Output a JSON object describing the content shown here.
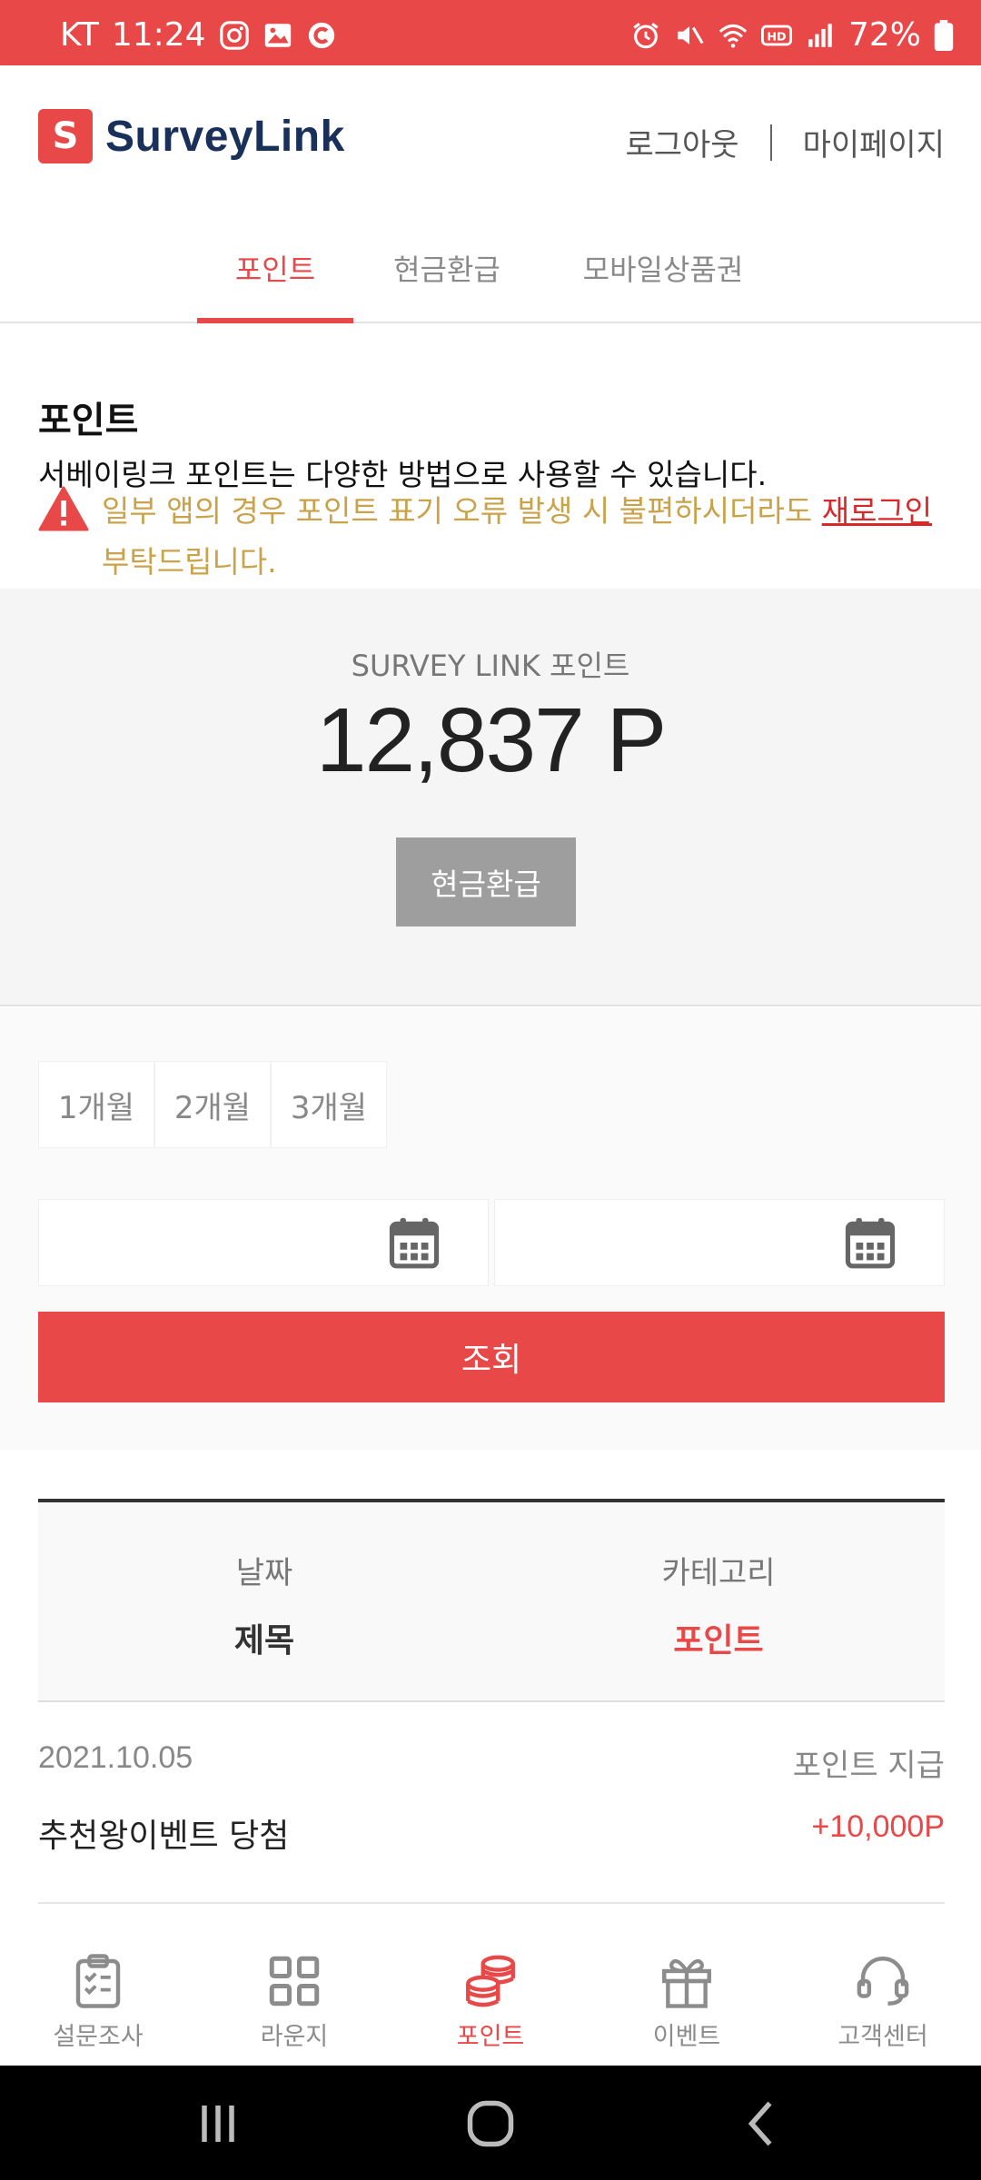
{
  "status_bar": {
    "carrier": "KT",
    "time": "11:24",
    "battery": "72%"
  },
  "header": {
    "logo_mark": "S",
    "logo_text": "SurveyLink",
    "logout": "로그아웃",
    "mypage": "마이페이지"
  },
  "tabs": [
    {
      "label": "포인트",
      "active": true
    },
    {
      "label": "현금환급",
      "active": false
    },
    {
      "label": "모바일상품권",
      "active": false
    }
  ],
  "info": {
    "title": "포인트",
    "description": "서베이링크 포인트는 다양한 방법으로 사용할 수 있습니다.",
    "notice_text": "일부 앱의 경우 포인트 표기 오류 발생 시 불편하시더라도 ",
    "notice_link": "재로그인",
    "notice_suffix": " 부탁드립니다."
  },
  "points": {
    "label": "SURVEY LINK 포인트",
    "value": "12,837 P",
    "cash_button": "현금환급"
  },
  "filter": {
    "periods": [
      "1개월",
      "2개월",
      "3개월"
    ],
    "start_date": "",
    "end_date": "",
    "search_button": "조회"
  },
  "table": {
    "header_date": "날짜",
    "header_title": "제목",
    "header_category": "카테고리",
    "header_point": "포인트",
    "rows": [
      {
        "date": "2021.10.05",
        "category": "포인트 지급",
        "title": "추천왕이벤트 당첨",
        "points": "+10,000P"
      }
    ]
  },
  "bottom_nav": [
    {
      "label": "설문조사",
      "icon": "clipboard-icon",
      "active": false
    },
    {
      "label": "라운지",
      "icon": "grid-icon",
      "active": false
    },
    {
      "label": "포인트",
      "icon": "coins-icon",
      "active": true
    },
    {
      "label": "이벤트",
      "icon": "gift-icon",
      "active": false
    },
    {
      "label": "고객센터",
      "icon": "headset-icon",
      "active": false
    }
  ],
  "colors": {
    "brand_red": "#e94849",
    "notice_yellow": "#c9a24a",
    "logo_navy": "#18305a"
  }
}
